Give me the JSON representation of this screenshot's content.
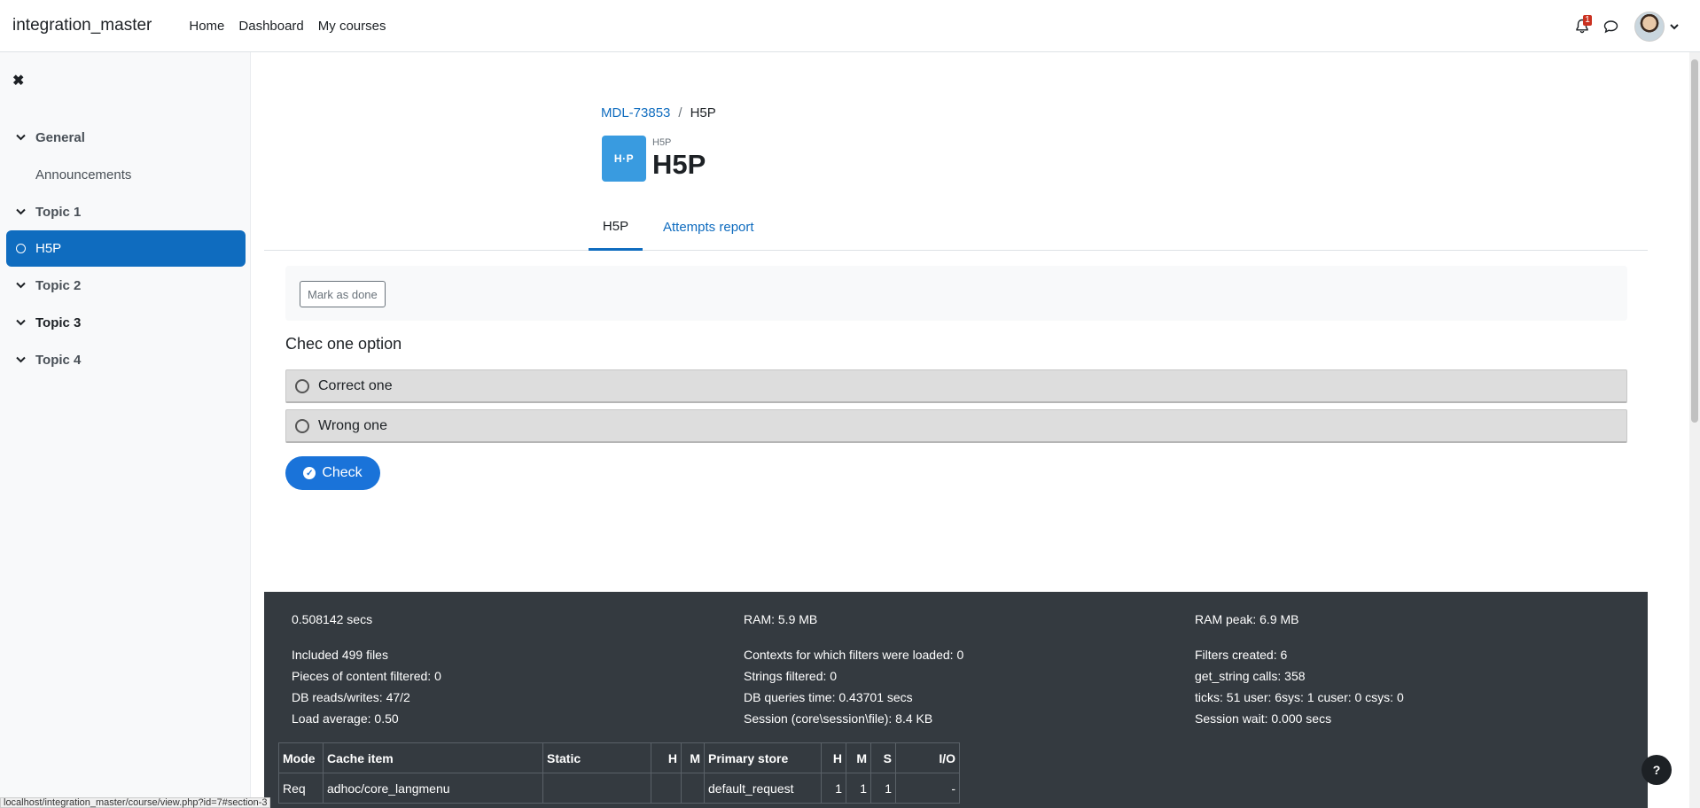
{
  "navbar": {
    "brand": "integration_master",
    "links": [
      "Home",
      "Dashboard",
      "My courses"
    ],
    "notification_count": "1"
  },
  "drawer": {
    "close_icon": "close-icon",
    "sections": [
      {
        "label": "General",
        "items": [
          "Announcements"
        ]
      },
      {
        "label": "Topic 1",
        "items": [
          "H5P"
        ]
      },
      {
        "label": "Topic 2",
        "items": []
      },
      {
        "label": "Topic 3",
        "items": []
      },
      {
        "label": "Topic 4",
        "items": []
      }
    ]
  },
  "breadcrumb": {
    "course": "MDL-73853",
    "separator": "/",
    "current": "H5P"
  },
  "activity": {
    "icon_text": "H·P",
    "type": "H5P",
    "title": "H5P"
  },
  "tabs": {
    "active": "H5P",
    "report": "Attempts report"
  },
  "completion": {
    "mark_done": "Mark as done"
  },
  "question": {
    "text": "Chec one option",
    "answers": [
      "Correct one",
      "Wrong one"
    ],
    "check_label": "Check"
  },
  "perf": {
    "col1": [
      "0.508142 secs",
      "Included 499 files",
      "Pieces of content filtered: 0",
      "DB reads/writes: 47/2",
      "Load average: 0.50"
    ],
    "col2": [
      "RAM: 5.9 MB",
      "Contexts for which filters were loaded: 0",
      "Strings filtered: 0",
      "DB queries time: 0.43701 secs",
      "Session (core\\session\\file): 8.4 KB"
    ],
    "col3": [
      "RAM peak: 6.9 MB",
      "Filters created: 6",
      "get_string calls: 358",
      "ticks: 51 user: 6sys: 1 cuser: 0 csys: 0",
      "Session wait: 0.000 secs"
    ],
    "table": {
      "headers": [
        "Mode",
        "Cache item",
        "Static",
        "H",
        "M",
        "Primary store",
        "H",
        "M",
        "S",
        "I/O"
      ],
      "row": [
        "Req",
        "adhoc/core_langmenu",
        "",
        "",
        "",
        "default_request",
        "1",
        "1",
        "1",
        "-"
      ]
    }
  },
  "status_url": "localhost/integration_master/course/view.php?id=7#section-3",
  "help": "?",
  "colors": {
    "primary": "#0f6cbf",
    "h5p_icon": "#399be0",
    "check_button": "#1a73d9",
    "footer": "#343a40"
  }
}
